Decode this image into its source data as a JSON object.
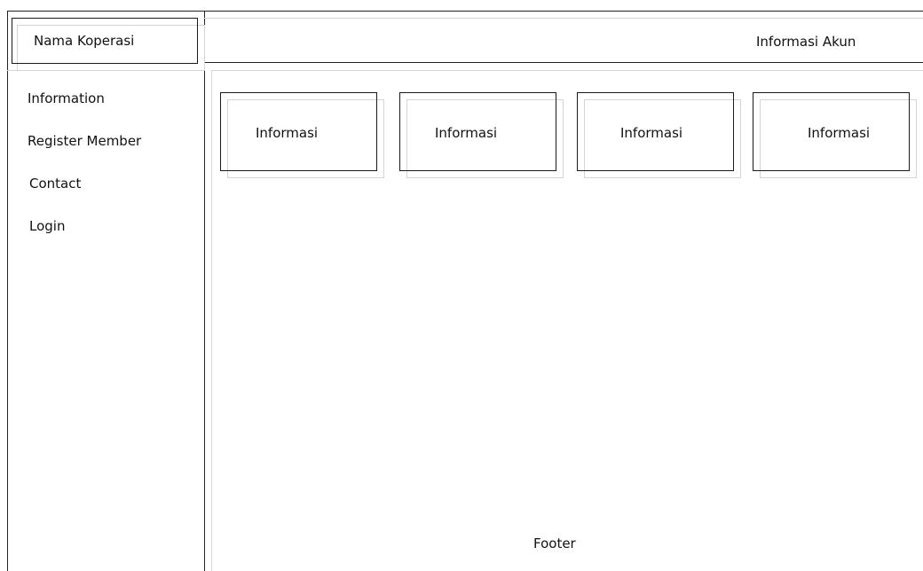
{
  "header": {
    "brand": "Nama Koperasi",
    "account": "Informasi Akun"
  },
  "sidebar": {
    "items": [
      {
        "label": "Information"
      },
      {
        "label": "Register Member"
      },
      {
        "label": "Contact"
      },
      {
        "label": "Login"
      }
    ]
  },
  "main": {
    "cards": [
      {
        "label": "Informasi"
      },
      {
        "label": "Informasi"
      },
      {
        "label": "Informasi"
      },
      {
        "label": "Informasi"
      }
    ]
  },
  "footer": {
    "text": "Footer"
  }
}
